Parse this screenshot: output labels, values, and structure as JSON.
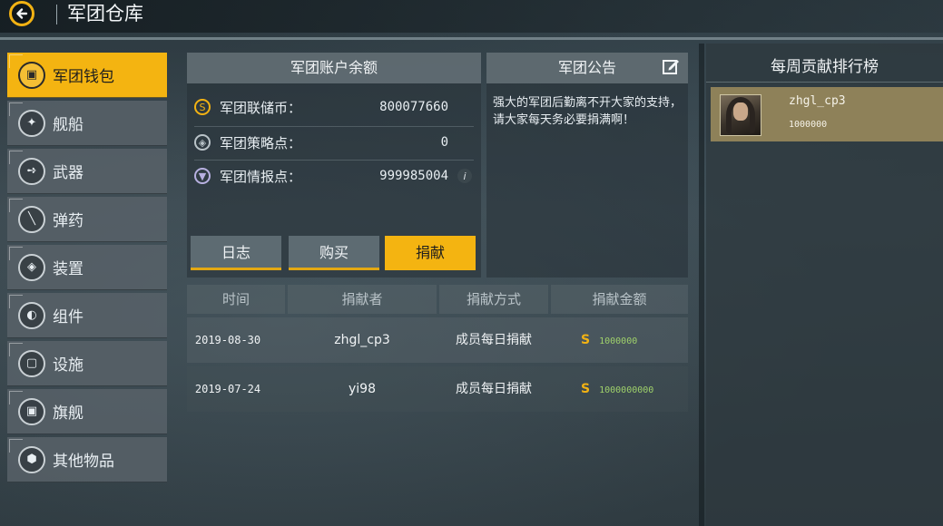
{
  "header": {
    "title": "军团仓库"
  },
  "sidebar": {
    "items": [
      {
        "label": "军团钱包",
        "icon": "wallet-icon",
        "active": true
      },
      {
        "label": "舰船",
        "icon": "ship-icon"
      },
      {
        "label": "武器",
        "icon": "weapon-icon"
      },
      {
        "label": "弹药",
        "icon": "ammo-icon"
      },
      {
        "label": "装置",
        "icon": "device-icon"
      },
      {
        "label": "组件",
        "icon": "component-icon"
      },
      {
        "label": "设施",
        "icon": "facility-icon"
      },
      {
        "label": "旗舰",
        "icon": "flagship-icon"
      },
      {
        "label": "其他物品",
        "icon": "box-icon"
      }
    ]
  },
  "balance": {
    "title": "军团账户余额",
    "rows": [
      {
        "label": "军团联储币：",
        "value": "800077660",
        "icon": "coin-icon"
      },
      {
        "label": "军团策略点：",
        "value": "0",
        "icon": "strategy-icon"
      },
      {
        "label": "军团情报点：",
        "value": "999985004",
        "icon": "intel-icon"
      }
    ],
    "info_symbol": "i"
  },
  "buttons": {
    "log": "日志",
    "buy": "购买",
    "donate": "捐献"
  },
  "notice": {
    "title": "军团公告",
    "text": "强大的军团后勤离不开大家的支持，请大家每天务必要捐满啊！"
  },
  "table": {
    "headers": [
      "时间",
      "捐献者",
      "捐献方式",
      "捐献金额"
    ],
    "rows": [
      {
        "date": "2019-08-30",
        "donor": "zhgl_cp3",
        "method": "成员每日捐献",
        "coin": "S",
        "amount": "1000000"
      },
      {
        "date": "2019-07-24",
        "donor": "yi98",
        "method": "成员每日捐献",
        "coin": "S",
        "amount": "1000000000"
      }
    ]
  },
  "ranking": {
    "title": "每周贡献排行榜",
    "entries": [
      {
        "name": "zhgl_cp3",
        "value": "1000000"
      }
    ]
  },
  "colors": {
    "accent": "#f4b411",
    "amount": "#9fd16b"
  }
}
